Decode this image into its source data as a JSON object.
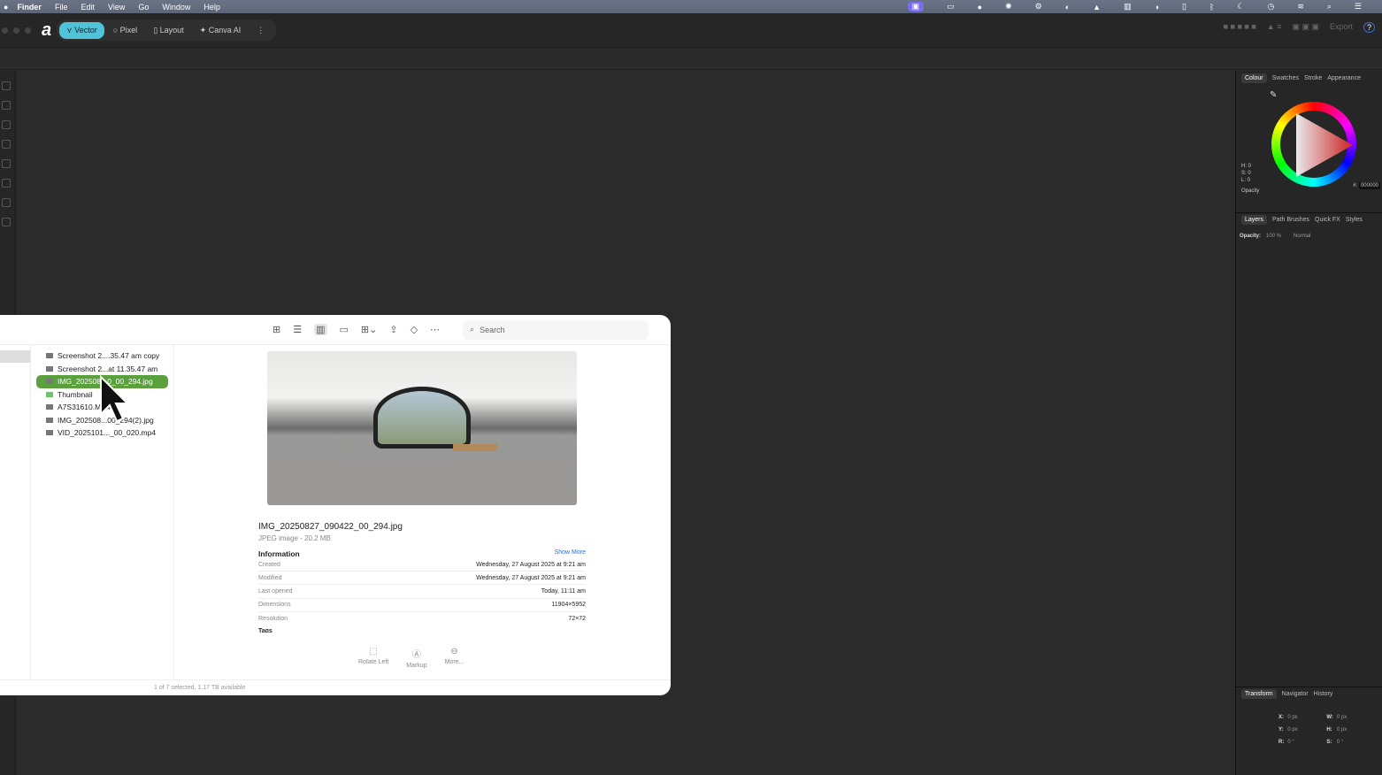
{
  "menubar": {
    "apple": "",
    "app": "Finder",
    "items": [
      "File",
      "Edit",
      "View",
      "Go",
      "Window",
      "Help"
    ]
  },
  "toolbar": {
    "modes": [
      "Vector",
      "Pixel",
      "Layout",
      "Canva AI"
    ],
    "export": "Export",
    "help": "?"
  },
  "colour_panel": {
    "tabs": [
      "Colour",
      "Swatches",
      "Stroke",
      "Appearance"
    ],
    "h": "H: 0",
    "s": "S: 0",
    "l": "L: 0",
    "opacity": "Opacity",
    "hex_label": "#:",
    "hex": "000000"
  },
  "layers_panel": {
    "tabs": [
      "Layers",
      "Path Brushes",
      "Quick FX",
      "Styles"
    ],
    "opacity_label": "Opacity:",
    "opacity": "100 %",
    "blend": "Normal"
  },
  "transform_panel": {
    "tabs": [
      "Transform",
      "Navigator",
      "History"
    ],
    "x": "X:",
    "x_val": "0 px",
    "y": "Y:",
    "y_val": "0 px",
    "w": "W:",
    "w_val": "0 px",
    "h": "H:",
    "h_val": "0 px",
    "r": "R:",
    "r_val": "0 °",
    "s": "S:",
    "s_val": "0 °"
  },
  "finder": {
    "search_placeholder": "Search",
    "files": [
      {
        "name": "Screenshot 2....35.47 am copy"
      },
      {
        "name": "Screenshot 2...at 11.35.47 am"
      },
      {
        "name": "IMG_202508...0_00_294.jpg",
        "selected": true
      },
      {
        "name": "Thumbnail",
        "folder": true
      },
      {
        "name": "A7S31610.MP4"
      },
      {
        "name": "IMG_202508...00_294(2).jpg"
      },
      {
        "name": "VID_2025101..._00_020.mp4"
      }
    ],
    "preview": {
      "filename": "IMG_20250827_090422_00_294.jpg",
      "kind": "JPEG image - 20.2 MB",
      "info_title": "Information",
      "show_more": "Show More",
      "rows": [
        [
          "Created",
          "Wednesday, 27 August 2025 at 9:21 am"
        ],
        [
          "Modified",
          "Wednesday, 27 August 2025 at 9:21 am"
        ],
        [
          "Last opened",
          "Today, 11:11 am"
        ],
        [
          "Dimensions",
          "11904×5952"
        ],
        [
          "Resolution",
          "72×72"
        ]
      ],
      "tags": "Tags"
    },
    "actions": [
      "Rotate Left",
      "Markup",
      "More..."
    ],
    "status": "1 of 7 selected, 1.17 TB available"
  }
}
